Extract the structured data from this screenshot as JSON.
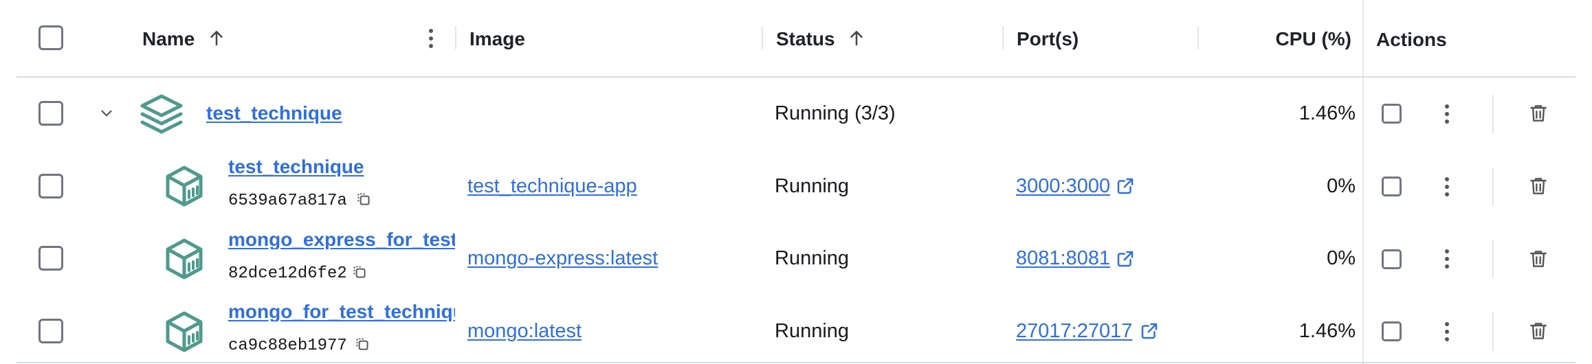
{
  "headers": {
    "name": "Name",
    "image": "Image",
    "status": "Status",
    "ports": "Port(s)",
    "cpu": "CPU (%)",
    "actions": "Actions"
  },
  "group": {
    "name": "test_technique",
    "status": "Running (3/3)",
    "cpu": "1.46%"
  },
  "containers": [
    {
      "name": "test_technique",
      "id": "6539a67a817a",
      "image": "test_technique-app",
      "status": "Running",
      "port": "3000:3000",
      "cpu": "0%"
    },
    {
      "name": "mongo_express_for_test_technique",
      "id": "82dce12d6fe2",
      "image": "mongo-express:latest",
      "status": "Running",
      "port": "8081:8081",
      "cpu": "0%"
    },
    {
      "name": "mongo_for_test_technique",
      "id": "ca9c88eb1977",
      "image": "mongo:latest",
      "status": "Running",
      "port": "27017:27017",
      "cpu": "1.46%"
    }
  ],
  "icons": {
    "sort": "arrow-up-icon",
    "column_menu": "vertical-dots-icon",
    "expand": "chevron-down-icon",
    "stack": "layers-icon",
    "container": "container-box-icon",
    "copy": "copy-icon",
    "external": "external-link-icon",
    "stop": "stop-square-icon",
    "more": "more-vertical-icon",
    "delete": "trash-icon"
  },
  "colors": {
    "link": "#2f6fde",
    "icon_teal": "#4f9a8c",
    "border": "#e2e4e8",
    "checkbox": "#707580"
  }
}
